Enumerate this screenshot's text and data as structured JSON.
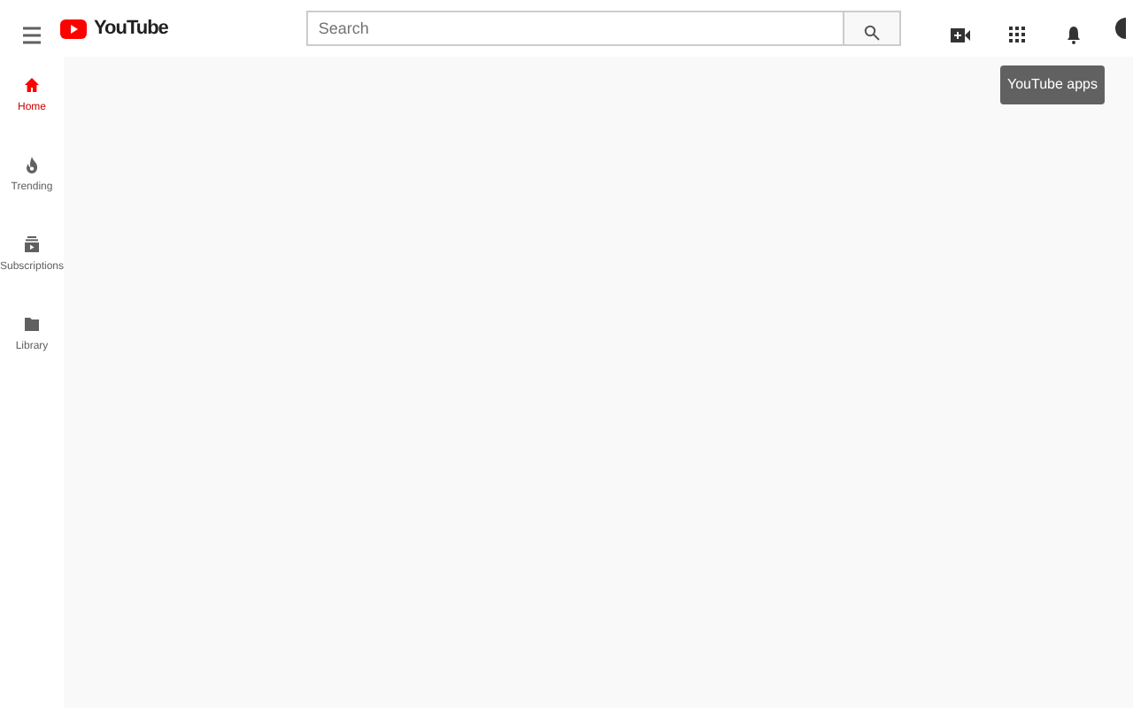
{
  "logo": {
    "text": "YouTube"
  },
  "search": {
    "placeholder": "Search"
  },
  "tooltip": {
    "text": "YouTube apps"
  },
  "sidebar": {
    "items": [
      {
        "label": "Home",
        "selected": true
      },
      {
        "label": "Trending",
        "selected": false
      },
      {
        "label": "Subscriptions",
        "selected": false
      },
      {
        "label": "Library",
        "selected": false
      }
    ]
  }
}
